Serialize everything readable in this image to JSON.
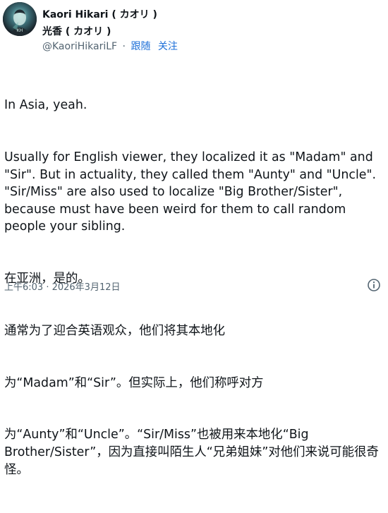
{
  "author": {
    "display_name": "Kaori Hikari ( カオリ )",
    "secondary_name": "光香 ( カオリ )",
    "handle": "@KaoriHikariLF",
    "separator": "·",
    "follow_label": "跟随",
    "follow_label_2": "关注"
  },
  "post": {
    "lines": [
      "In Asia, yeah.",
      "Usually for English viewer, they localized it as \"Madam\" and \"Sir\". But in actuality, they called them \"Aunty\" and \"Uncle\". \"Sir/Miss\" are also used to localize \"Big Brother/Sister\", because must have been weird for them to call random people your sibling.",
      "在亚洲，是的。",
      "通常为了迎合英语观众，他们将其本地化",
      "为“Madam”和“Sir”。但实际上，他们称呼对方",
      "为“Aunty”和“Uncle”。“Sir/Miss”也被用来本地化“Big Brother/Sister”，因为直接叫陌生人“兄弟姐妹”对他们来说可能很奇怪。"
    ]
  },
  "meta": {
    "timestamp": "上午6:03 · 2026年3月12日"
  },
  "icons": {
    "info": "info-icon",
    "avatar": "avatar-image"
  },
  "colors": {
    "link": "#1d6fd8",
    "secondary_text": "#536471",
    "text": "#0f1419"
  }
}
